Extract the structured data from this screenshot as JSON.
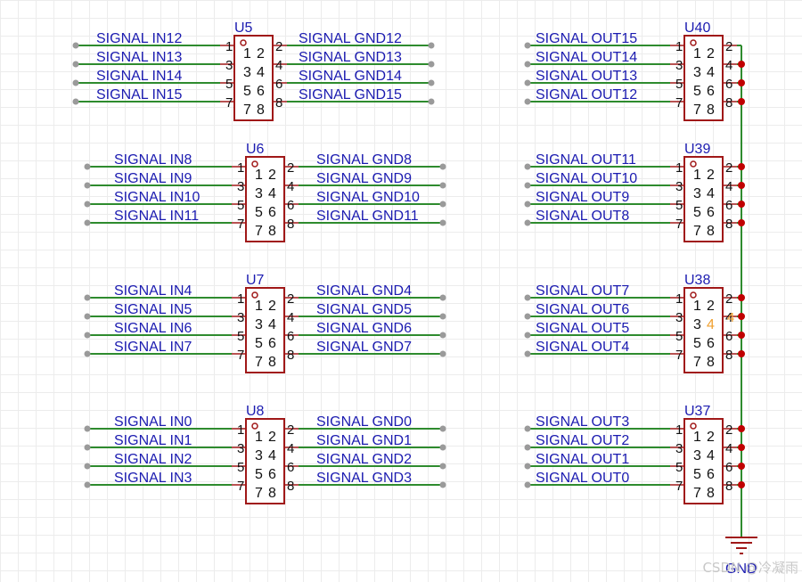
{
  "components": [
    {
      "ref": "U5",
      "left_nets": [
        "SIGNAL_IN12",
        "SIGNAL_IN13",
        "SIGNAL_IN14",
        "SIGNAL_IN15"
      ],
      "right_nets": [
        "SIGNAL_GND12",
        "SIGNAL_GND13",
        "SIGNAL_GND14",
        "SIGNAL_GND15"
      ],
      "right_tied_to_gnd": false
    },
    {
      "ref": "U6",
      "left_nets": [
        "SIGNAL_IN8",
        "SIGNAL_IN9",
        "SIGNAL_IN10",
        "SIGNAL_IN11"
      ],
      "right_nets": [
        "SIGNAL_GND8",
        "SIGNAL_GND9",
        "SIGNAL_GND10",
        "SIGNAL_GND11"
      ],
      "right_tied_to_gnd": false
    },
    {
      "ref": "U7",
      "left_nets": [
        "SIGNAL_IN4",
        "SIGNAL_IN5",
        "SIGNAL_IN6",
        "SIGNAL_IN7"
      ],
      "right_nets": [
        "SIGNAL_GND4",
        "SIGNAL_GND5",
        "SIGNAL_GND6",
        "SIGNAL_GND7"
      ],
      "right_tied_to_gnd": false
    },
    {
      "ref": "U8",
      "left_nets": [
        "SIGNAL_IN0",
        "SIGNAL_IN1",
        "SIGNAL_IN2",
        "SIGNAL_IN3"
      ],
      "right_nets": [
        "SIGNAL_GND0",
        "SIGNAL_GND1",
        "SIGNAL_GND2",
        "SIGNAL_GND3"
      ],
      "right_tied_to_gnd": false
    },
    {
      "ref": "U40",
      "left_nets": [
        "SIGNAL_OUT15",
        "SIGNAL_OUT14",
        "SIGNAL_OUT13",
        "SIGNAL_OUT12"
      ],
      "right_nets": [],
      "right_tied_to_gnd": true
    },
    {
      "ref": "U39",
      "left_nets": [
        "SIGNAL_OUT11",
        "SIGNAL_OUT10",
        "SIGNAL_OUT9",
        "SIGNAL_OUT8"
      ],
      "right_nets": [],
      "right_tied_to_gnd": true
    },
    {
      "ref": "U38",
      "left_nets": [
        "SIGNAL_OUT7",
        "SIGNAL_OUT6",
        "SIGNAL_OUT5",
        "SIGNAL_OUT4"
      ],
      "right_nets": [],
      "right_tied_to_gnd": true,
      "highlight_pin": "4"
    },
    {
      "ref": "U37",
      "left_nets": [
        "SIGNAL_OUT3",
        "SIGNAL_OUT2",
        "SIGNAL_OUT1",
        "SIGNAL_OUT0"
      ],
      "right_nets": [],
      "right_tied_to_gnd": true
    }
  ],
  "pin_numbers": {
    "left": [
      "1",
      "3",
      "5",
      "7"
    ],
    "right": [
      "2",
      "4",
      "6",
      "8"
    ],
    "body_rows": [
      "1 2",
      "3 4",
      "5 6",
      "7 8"
    ]
  },
  "ground": {
    "label": "GND"
  },
  "watermark": "CSDN @冷凝雨",
  "colors": {
    "wire": "#2e8b2e",
    "body": "#a01818",
    "pin_line": "#a01818",
    "net_label": "#1b1bb0",
    "ref_label": "#1b1bb0",
    "pin_number": "#111111",
    "junction": "#c00000",
    "open_end": "#9a9a9a",
    "highlight": "#f0a030"
  }
}
